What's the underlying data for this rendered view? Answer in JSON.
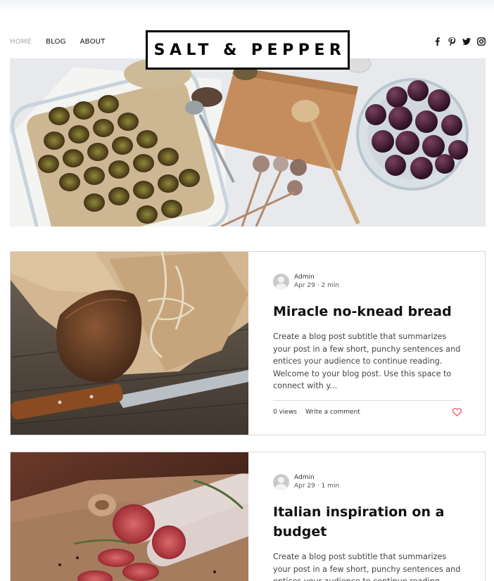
{
  "nav": {
    "items": [
      {
        "label": "HOME",
        "active": true
      },
      {
        "label": "BLOG",
        "active": false
      },
      {
        "label": "ABOUT",
        "active": false
      }
    ]
  },
  "logo": {
    "text": "SALT & PEPPER"
  },
  "social": {
    "icons": [
      "facebook-icon",
      "pinterest-icon",
      "twitter-icon",
      "instagram-icon"
    ]
  },
  "colors": {
    "heart": "#e8495b",
    "text": "#111111",
    "border": "#d8d8d8"
  },
  "posts": [
    {
      "author": "Admin",
      "date": "Apr 29",
      "read_time": "2 min",
      "title": "Miracle no-knead bread",
      "excerpt": "Create a blog post subtitle that summarizes your post in a few short, punchy sentences and entices your audience to continue reading. Welcome to your blog post. Use this space to connect with y...",
      "views": "0 views",
      "comment_label": "Write a comment"
    },
    {
      "author": "Admin",
      "date": "Apr 29",
      "read_time": "1 min",
      "title": "Italian inspiration on a budget",
      "excerpt": "Create a blog post subtitle that summarizes your post in a few short, punchy sentences and entices your audience to continue reading."
    }
  ],
  "separator": "·"
}
